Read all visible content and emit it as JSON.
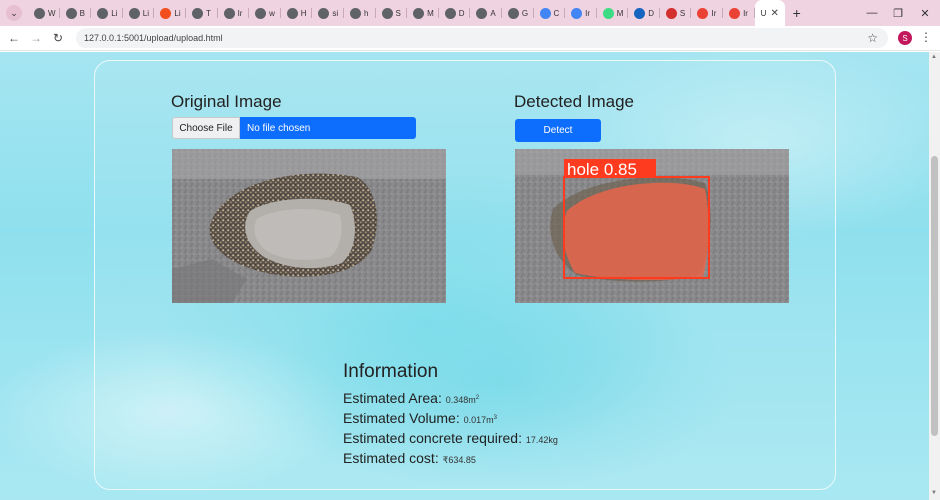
{
  "browser": {
    "tabs": [
      {
        "label": "W",
        "icon": "globe-icon",
        "color": "#5f6368"
      },
      {
        "label": "B",
        "icon": "globe-icon",
        "color": "#5f6368"
      },
      {
        "label": "Li",
        "icon": "globe-icon",
        "color": "#5f6368"
      },
      {
        "label": "Li",
        "icon": "globe-icon",
        "color": "#5f6368"
      },
      {
        "label": "Li",
        "icon": "figma-icon",
        "color": "#f24e1e"
      },
      {
        "label": "T",
        "icon": "globe-icon",
        "color": "#5f6368"
      },
      {
        "label": "Ir",
        "icon": "globe-icon",
        "color": "#5f6368"
      },
      {
        "label": "w",
        "icon": "globe-icon",
        "color": "#5f6368"
      },
      {
        "label": "H",
        "icon": "globe-icon",
        "color": "#5f6368"
      },
      {
        "label": "si",
        "icon": "globe-icon",
        "color": "#5f6368"
      },
      {
        "label": "h",
        "icon": "globe-icon",
        "color": "#5f6368"
      },
      {
        "label": "S",
        "icon": "globe-icon",
        "color": "#5f6368"
      },
      {
        "label": "M",
        "icon": "globe-icon",
        "color": "#5f6368"
      },
      {
        "label": "D",
        "icon": "globe-icon",
        "color": "#5f6368"
      },
      {
        "label": "A",
        "icon": "globe-icon",
        "color": "#5f6368"
      },
      {
        "label": "G",
        "icon": "globe-icon",
        "color": "#5f6368"
      },
      {
        "label": "C",
        "icon": "google-icon",
        "color": "#4285f4"
      },
      {
        "label": "Ir",
        "icon": "google-icon",
        "color": "#4285f4"
      },
      {
        "label": "M",
        "icon": "android-icon",
        "color": "#3ddc84"
      },
      {
        "label": "D",
        "icon": "card-icon",
        "color": "#1565c0"
      },
      {
        "label": "S",
        "icon": "record-icon",
        "color": "#d32f2f"
      },
      {
        "label": "Ir",
        "icon": "gmail-icon",
        "color": "#ea4335"
      },
      {
        "label": "Ir",
        "icon": "gmail-icon",
        "color": "#ea4335"
      }
    ],
    "active_tab_label": "U",
    "url": "127.0.0.1:5001/upload/upload.html",
    "profile_initial": "S",
    "tabstrip_color": "#f0d3e0"
  },
  "page": {
    "original_heading": "Original Image",
    "detected_heading": "Detected Image",
    "choose_file_label": "Choose File",
    "file_status": "No file chosen",
    "detect_label": "Detect",
    "detection_label": "hole 0.85",
    "button_color": "#0d6efd",
    "info": {
      "title": "Information",
      "area_label": "Estimated Area:",
      "area_value": "0.348m",
      "area_unit_sup": "2",
      "volume_label": "Estimated Volume:",
      "volume_value": "0.017m",
      "volume_unit_sup": "3",
      "concrete_label": "Estimated concrete required:",
      "concrete_value": "17.42kg",
      "cost_label": "Estimated cost:",
      "cost_value": "₹634.85"
    }
  }
}
